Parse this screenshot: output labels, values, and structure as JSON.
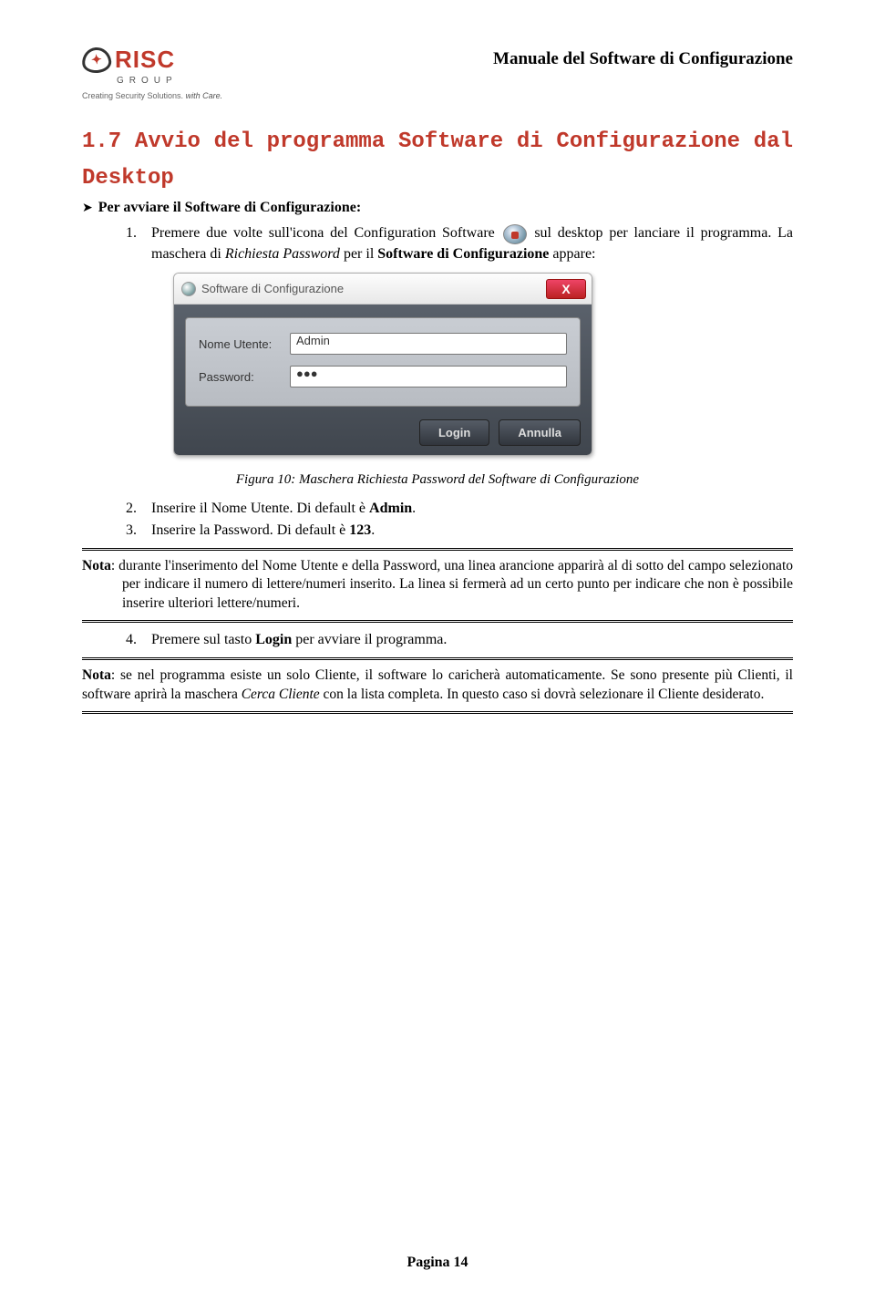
{
  "header": {
    "logo_brand": "RISC",
    "logo_group": "GROUP",
    "logo_tag_1": "Creating Security Solutions.",
    "logo_tag_2": "with Care.",
    "doc_title": "Manuale del Software di Configurazione"
  },
  "section": {
    "heading_line1": "1.7 Avvio del programma Software di Configurazione dal",
    "heading_line2": "Desktop",
    "arrow_text": "Per avviare il Software di Configurazione:"
  },
  "steps": {
    "n1": "1.",
    "s1a": "Premere due volte sull'icona del Configuration Software ",
    "s1b": " sul desktop per lanciare il programma. La maschera di ",
    "s1b_i": "Richiesta Password",
    "s1c": " per il ",
    "s1c_b": "Software di Configurazione",
    "s1d": " appare:",
    "n2": "2.",
    "s2": "Inserire il Nome Utente. Di default è ",
    "s2_b": "Admin",
    "s2_end": ".",
    "n3": "3.",
    "s3": "Inserire la Password. Di default è ",
    "s3_b": "123",
    "s3_end": ".",
    "n4": "4.",
    "s4": "Premere sul tasto ",
    "s4_b": "Login",
    "s4_end": " per avviare il programma."
  },
  "dialog": {
    "title": "Software di Configurazione",
    "close": "X",
    "label_user": "Nome Utente:",
    "value_user": "Admin",
    "label_pass": "Password:",
    "value_pass": "●●●",
    "btn_login": "Login",
    "btn_cancel": "Annulla"
  },
  "caption": "Figura 10: Maschera Richiesta Password del Software di Configurazione",
  "note1": {
    "bold": "Nota",
    "text": ": durante l'inserimento del Nome Utente e della Password, una linea arancione apparirà al di sotto del campo selezionato per indicare il numero di lettere/numeri inserito. La linea si fermerà ad un certo punto per indicare che non è possibile inserire ulteriori lettere/numeri."
  },
  "note2": {
    "bold": "Nota",
    "a": ": se nel programma esiste un solo Cliente, il software lo caricherà automaticamente. Se sono presente più Clienti, il software aprirà la maschera ",
    "i": "Cerca Cliente",
    "b": " con la lista completa. In questo caso si dovrà selezionare il Cliente desiderato."
  },
  "page_num": "Pagina 14"
}
